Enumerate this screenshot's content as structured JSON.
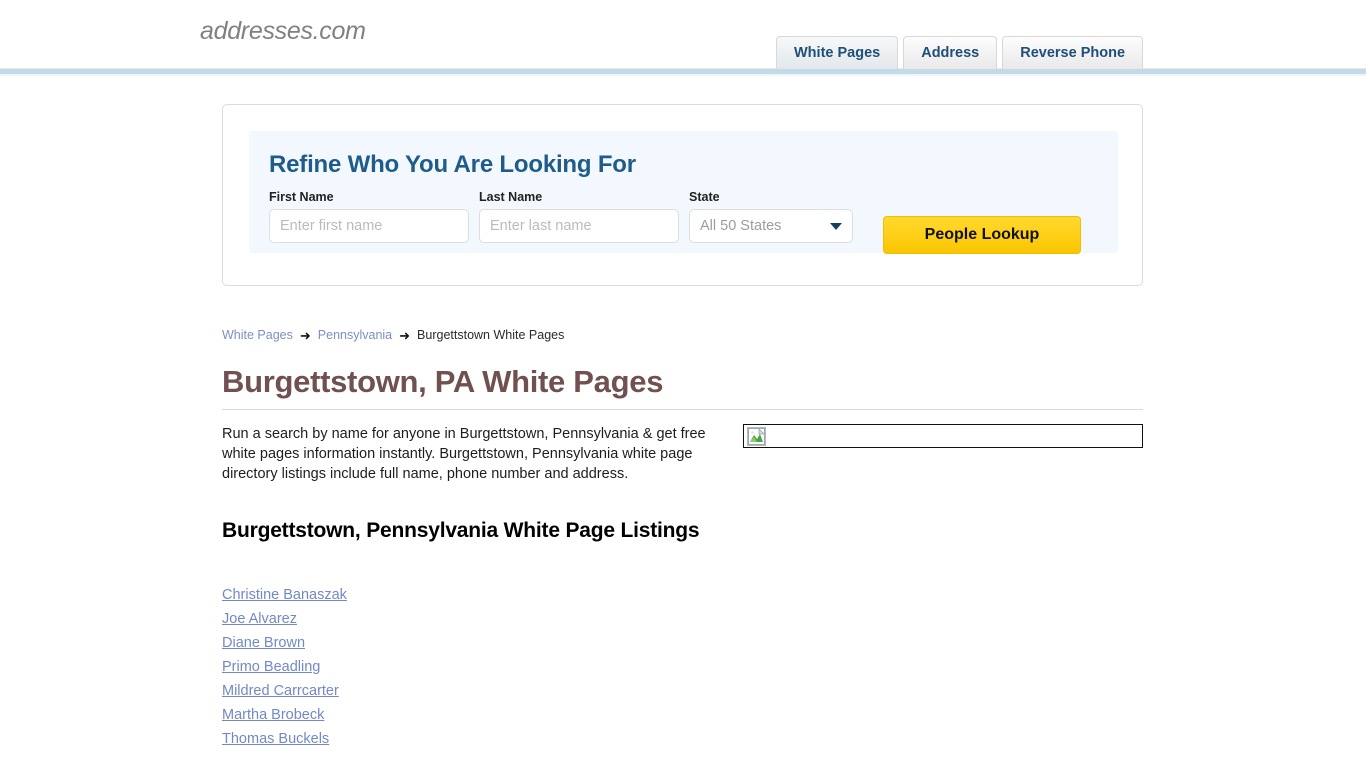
{
  "header": {
    "logo_text": "addresses.com",
    "tabs": [
      {
        "label": "White Pages",
        "active": true
      },
      {
        "label": "Address",
        "active": false
      },
      {
        "label": "Reverse Phone",
        "active": false
      }
    ]
  },
  "search_panel": {
    "title": "Refine Who You Are Looking For",
    "first_name": {
      "label": "First Name",
      "placeholder": "Enter first name",
      "value": ""
    },
    "last_name": {
      "label": "Last Name",
      "placeholder": "Enter last name",
      "value": ""
    },
    "state": {
      "label": "State",
      "selected": "All 50 States"
    },
    "submit_label": "People Lookup"
  },
  "breadcrumb": {
    "items": [
      {
        "label": "White Pages",
        "link": true
      },
      {
        "label": "Pennsylvania",
        "link": true
      },
      {
        "label": "Burgettstown White Pages",
        "link": false
      }
    ],
    "separator": "➜"
  },
  "page": {
    "title": "Burgettstown, PA White Pages",
    "intro": "Run a search by name for anyone in Burgettstown, Pennsylvania & get free white pages information instantly. Burgettstown, Pennsylvania white page directory listings include full name, phone number and address.",
    "listings_heading": "Burgettstown, Pennsylvania White Page Listings",
    "listings": [
      "Christine Banaszak",
      "Joe Alvarez",
      "Diane Brown",
      "Primo Beadling",
      "Mildred Carrcarter",
      "Martha Brobeck",
      "Thomas Buckels"
    ]
  },
  "colors": {
    "tab_text": "#1f4e79",
    "header_band": "#c3dbe8",
    "panel_inner_bg": "#f2f8fd",
    "refine_title": "#1f5c8b",
    "page_title": "#70514f",
    "link": "#7289c6",
    "button_gold": "#ffd11a"
  }
}
